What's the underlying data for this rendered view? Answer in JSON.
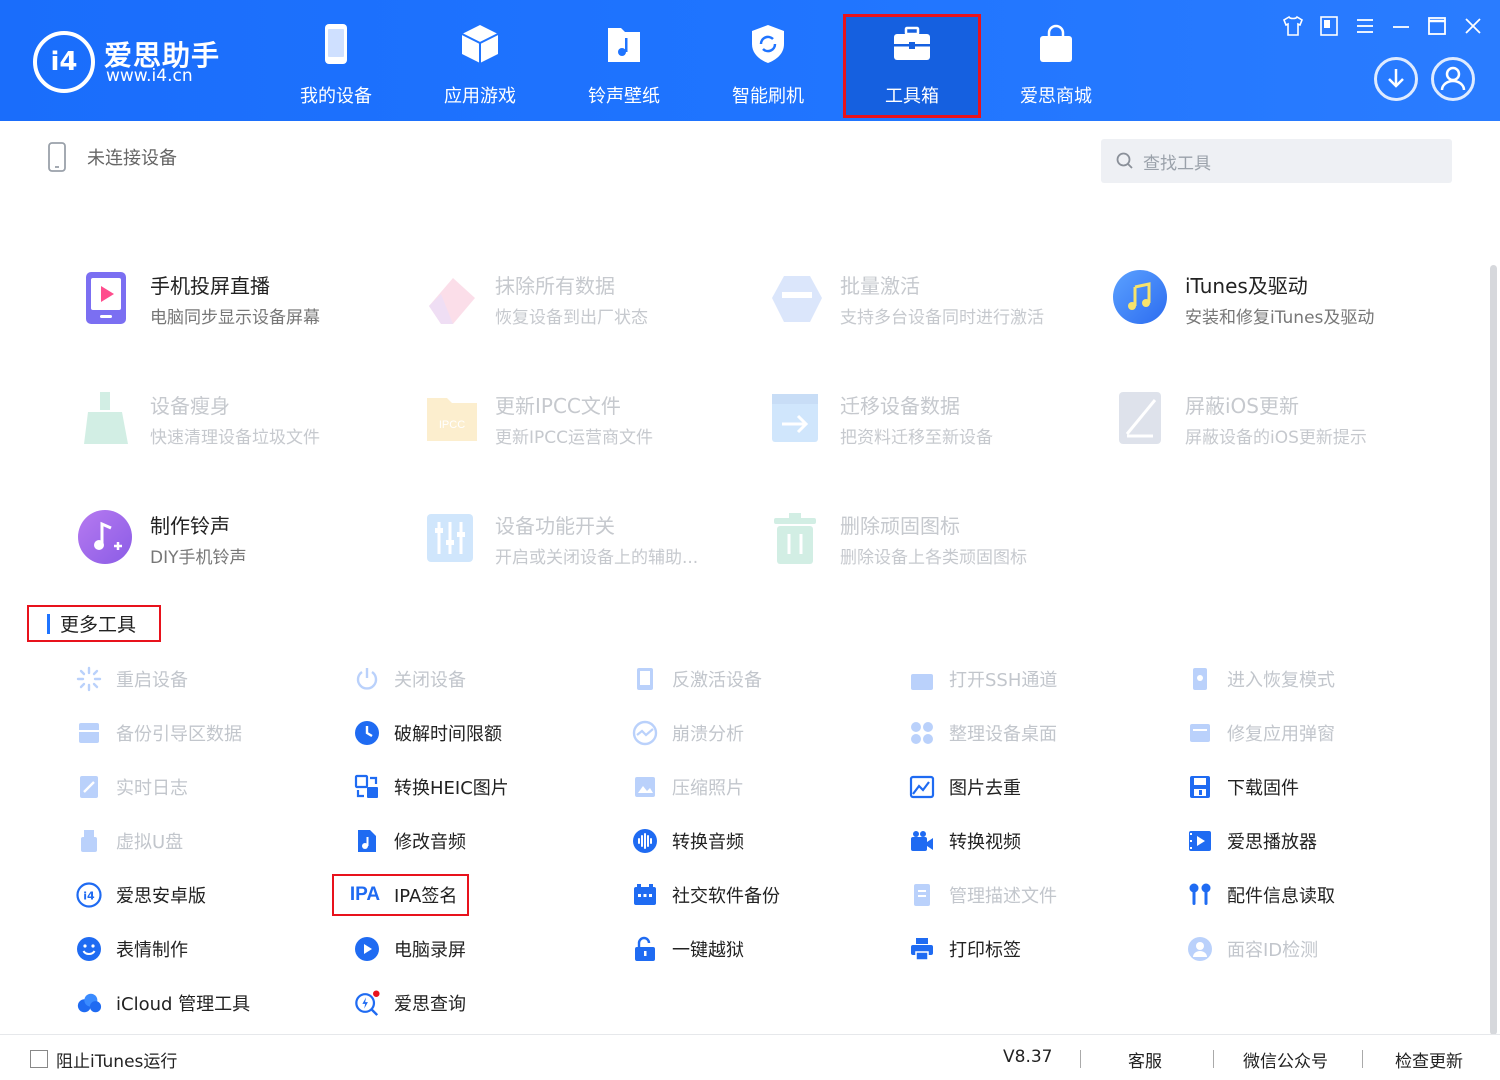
{
  "header": {
    "brand_name": "爱思助手",
    "brand_url": "www.i4.cn",
    "nav": [
      {
        "label": "我的设备"
      },
      {
        "label": "应用游戏"
      },
      {
        "label": "铃声壁纸"
      },
      {
        "label": "智能刷机"
      },
      {
        "label": "工具箱",
        "active": true
      },
      {
        "label": "爱思商城"
      }
    ]
  },
  "status": {
    "device": "未连接设备",
    "search_placeholder": "查找工具"
  },
  "cards": [
    {
      "title": "手机投屏直播",
      "desc": "电脑同步显示设备屏幕",
      "enabled": true,
      "icon": "screen-cast-icon"
    },
    {
      "title": "抹除所有数据",
      "desc": "恢复设备到出厂状态",
      "enabled": false,
      "icon": "eraser-icon"
    },
    {
      "title": "批量激活",
      "desc": "支持多台设备同时进行激活",
      "enabled": false,
      "icon": "batch-activate-icon"
    },
    {
      "title": "iTunes及驱动",
      "desc": "安装和修复iTunes及驱动",
      "enabled": true,
      "icon": "music-note-icon"
    },
    {
      "title": "设备瘦身",
      "desc": "快速清理设备垃圾文件",
      "enabled": false,
      "icon": "broom-icon"
    },
    {
      "title": "更新IPCC文件",
      "desc": "更新IPCC运营商文件",
      "enabled": false,
      "icon": "ipcc-folder-icon"
    },
    {
      "title": "迁移设备数据",
      "desc": "把资料迁移至新设备",
      "enabled": false,
      "icon": "migrate-icon"
    },
    {
      "title": "屏蔽iOS更新",
      "desc": "屏蔽设备的iOS更新提示",
      "enabled": false,
      "icon": "block-update-icon"
    },
    {
      "title": "制作铃声",
      "desc": "DIY手机铃声",
      "enabled": true,
      "icon": "ringtone-icon"
    },
    {
      "title": "设备功能开关",
      "desc": "开启或关闭设备上的辅助...",
      "enabled": false,
      "icon": "sliders-icon"
    },
    {
      "title": "删除顽固图标",
      "desc": "删除设备上各类顽固图标",
      "enabled": false,
      "icon": "trash-icon"
    }
  ],
  "more_tools": {
    "title": "更多工具",
    "items": [
      {
        "label": "重启设备",
        "enabled": false,
        "icon": "restart-icon"
      },
      {
        "label": "关闭设备",
        "enabled": false,
        "icon": "power-icon"
      },
      {
        "label": "反激活设备",
        "enabled": false,
        "icon": "deactivate-icon"
      },
      {
        "label": "打开SSH通道",
        "enabled": false,
        "icon": "ssh-icon"
      },
      {
        "label": "进入恢复模式",
        "enabled": false,
        "icon": "recovery-icon"
      },
      {
        "label": "备份引导区数据",
        "enabled": false,
        "icon": "backup-boot-icon"
      },
      {
        "label": "破解时间限额",
        "enabled": true,
        "icon": "clock-icon"
      },
      {
        "label": "崩溃分析",
        "enabled": false,
        "icon": "crash-analysis-icon"
      },
      {
        "label": "整理设备桌面",
        "enabled": false,
        "icon": "grid-icon"
      },
      {
        "label": "修复应用弹窗",
        "enabled": false,
        "icon": "fix-popup-icon"
      },
      {
        "label": "实时日志",
        "enabled": false,
        "icon": "log-icon"
      },
      {
        "label": "转换HEIC图片",
        "enabled": true,
        "icon": "convert-heic-icon"
      },
      {
        "label": "压缩照片",
        "enabled": false,
        "icon": "compress-photo-icon"
      },
      {
        "label": "图片去重",
        "enabled": true,
        "icon": "dedupe-image-icon"
      },
      {
        "label": "下载固件",
        "enabled": true,
        "icon": "download-firmware-icon"
      },
      {
        "label": "虚拟U盘",
        "enabled": false,
        "icon": "usb-drive-icon"
      },
      {
        "label": "修改音频",
        "enabled": true,
        "icon": "audio-file-icon"
      },
      {
        "label": "转换音频",
        "enabled": true,
        "icon": "audio-wave-icon"
      },
      {
        "label": "转换视频",
        "enabled": true,
        "icon": "video-camera-icon"
      },
      {
        "label": "爱思播放器",
        "enabled": true,
        "icon": "player-icon"
      },
      {
        "label": "爱思安卓版",
        "enabled": true,
        "icon": "i4-logo-icon"
      },
      {
        "label": "IPA签名",
        "enabled": true,
        "icon": "ipa-icon",
        "icon_text": "IPA"
      },
      {
        "label": "社交软件备份",
        "enabled": true,
        "icon": "chat-backup-icon"
      },
      {
        "label": "管理描述文件",
        "enabled": false,
        "icon": "profile-icon"
      },
      {
        "label": "配件信息读取",
        "enabled": true,
        "icon": "earbuds-icon"
      },
      {
        "label": "表情制作",
        "enabled": true,
        "icon": "smile-icon"
      },
      {
        "label": "电脑录屏",
        "enabled": true,
        "icon": "record-icon"
      },
      {
        "label": "一键越狱",
        "enabled": true,
        "icon": "unlock-icon"
      },
      {
        "label": "打印标签",
        "enabled": true,
        "icon": "printer-icon"
      },
      {
        "label": "面容ID检测",
        "enabled": false,
        "icon": "face-id-icon"
      },
      {
        "label": "iCloud 管理工具",
        "enabled": true,
        "icon": "cloud-icon"
      },
      {
        "label": "爱思查询",
        "enabled": true,
        "icon": "query-icon"
      }
    ]
  },
  "footer": {
    "block_itunes": "阻止iTunes运行",
    "version": "V8.37",
    "support": "客服",
    "wechat": "微信公众号",
    "check_update": "检查更新"
  },
  "colors": {
    "header_blue": "#1f74ff",
    "highlight_red": "#e8121c",
    "icon_blue": "#1f6bf2"
  }
}
